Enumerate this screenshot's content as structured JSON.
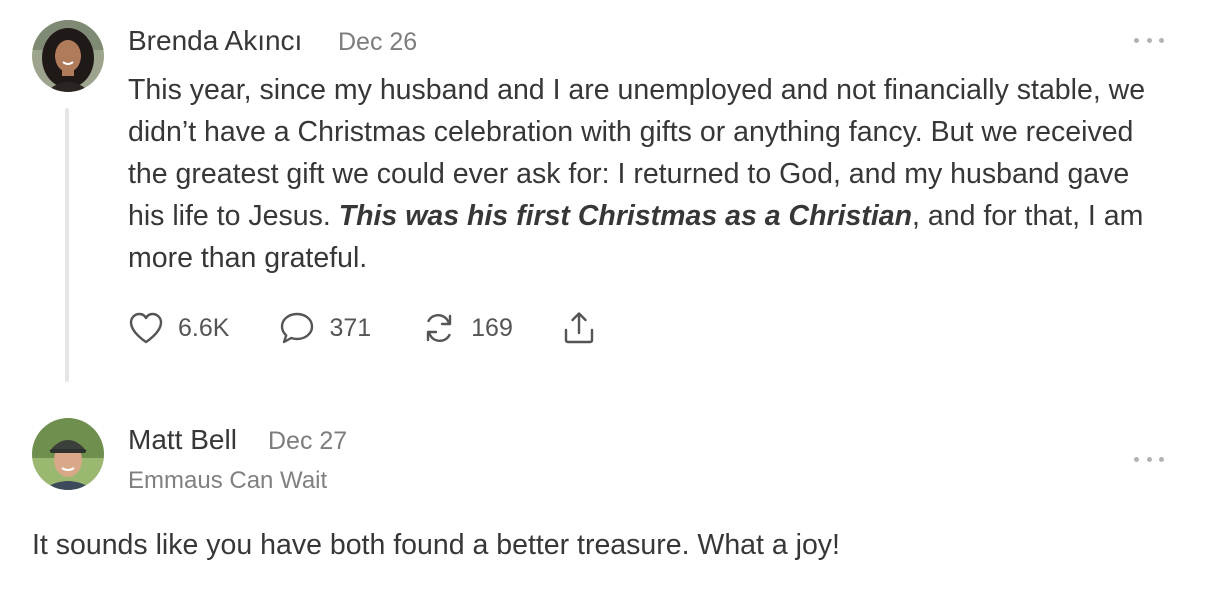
{
  "comments": [
    {
      "author": "Brenda Akıncı",
      "date": "Dec 26",
      "text_parts": {
        "p1": "This year, since my husband and I are unemployed and not financially stable, we didn’t have a Christmas celebration with gifts or anything fancy. But we received the greatest gift we could ever ask for: I returned to God, and my husband gave his life to Jesus. ",
        "emphasis": "This was his first Christmas as a Christian",
        "p2": ", and for that, I am more than grateful."
      },
      "actions": {
        "likes": "6.6K",
        "replies": "371",
        "restacks": "169"
      }
    },
    {
      "author": "Matt Bell",
      "date": "Dec 27",
      "subtitle": "Emmaus Can Wait",
      "text": "It sounds like you have both found a better treasure. What a joy!"
    }
  ],
  "icons": {
    "like": "heart-icon",
    "reply": "speech-bubble-icon",
    "restack": "refresh-arrows-icon",
    "share": "share-upload-icon",
    "more": "ellipsis-icon"
  },
  "colors": {
    "text": "#363737",
    "muted": "#7d7d7d",
    "thread_line": "#e5e5e5"
  }
}
